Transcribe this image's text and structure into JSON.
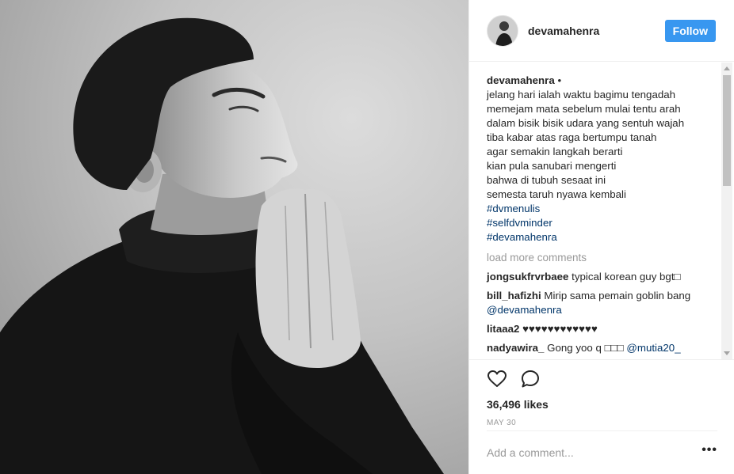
{
  "post": {
    "photo_alt": "post photo",
    "header": {
      "username": "devamahenra",
      "follow_label": "Follow"
    },
    "caption": {
      "username": "devamahenra",
      "dot": " •",
      "lines": [
        "jelang hari ialah waktu bagimu tengadah",
        "memejam mata sebelum mulai tentu arah",
        "dalam bisik bisik udara yang sentuh wajah",
        "tiba kabar atas raga bertumpu tanah",
        "agar semakin langkah berarti",
        "kian pula sanubari mengerti",
        "bahwa di tubuh sesaat ini",
        "semesta taruh nyawa kembali"
      ],
      "hashtags": [
        "#dvmenulis",
        "#selfdvminder",
        "#devamahenra"
      ]
    },
    "load_more_label": "load more comments",
    "comments": [
      {
        "username": "jongsukfrvrbaee",
        "text": "typical korean guy bgt□",
        "mention": ""
      },
      {
        "username": "bill_hafizhi",
        "text": "Mirip sama pemain goblin bang",
        "mention": "@devamahenra"
      },
      {
        "username": "litaaa2",
        "text": "♥♥♥♥♥♥♥♥♥♥♥♥",
        "mention": ""
      },
      {
        "username": "nadyawira_",
        "text": "Gong yoo q □□□",
        "mention": "@mutia20_"
      }
    ],
    "likes_label": "36,496 likes",
    "date_label": "MAY 30",
    "add_comment_placeholder": "Add a comment...",
    "more_label": "•••",
    "icons": {
      "like": "heart-icon",
      "comment": "comment-bubble-icon"
    },
    "colors": {
      "follow_button": "#3897f0",
      "hashtag": "#003569",
      "muted": "#999999"
    }
  }
}
